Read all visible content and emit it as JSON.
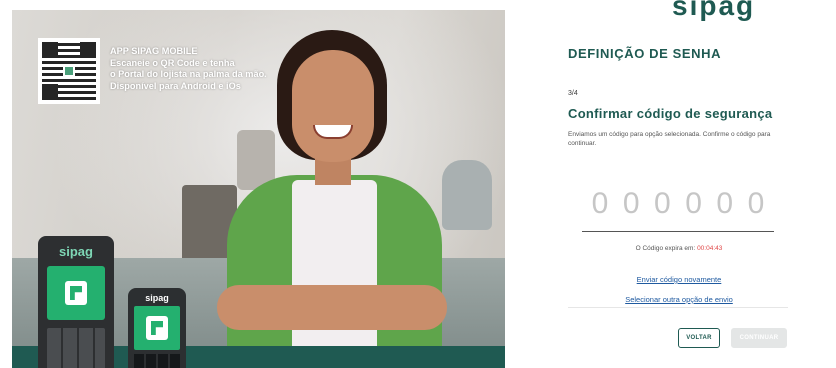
{
  "header": {
    "logo_text": "sipag"
  },
  "promo": {
    "lines": [
      "APP SIPAG MOBILE",
      "Escaneie o QR Code e tenha",
      "o Portal do lojista na palma da mão.",
      "Disponível para Android e iOs"
    ],
    "pos_brand": "sipag",
    "phone_brand": "sipag"
  },
  "form": {
    "page_title": "DEFINIÇÃO DE SENHA",
    "step": "3/4",
    "section_title": "Confirmar código de segurança",
    "description": "Enviamos um código para opção selecionada. Confirme o código para continuar.",
    "code_digits": [
      "0",
      "0",
      "0",
      "0",
      "0",
      "0"
    ],
    "expiry_label": "O Código expira em:",
    "expiry_timer": "00:04:43",
    "resend_link": "Enviar código novamente",
    "other_option_link": "Selecionar outra opção de envio",
    "back_button": "VOLTAR",
    "continue_button": "CONTINUAR"
  },
  "colors": {
    "brand_green": "#1f5a52",
    "link_blue": "#1f5aa0",
    "timer_red": "#e04747",
    "disabled_button": "#e4e6e6"
  },
  "icons": [
    "qr-code-icon",
    "sipag-logo-icon"
  ]
}
